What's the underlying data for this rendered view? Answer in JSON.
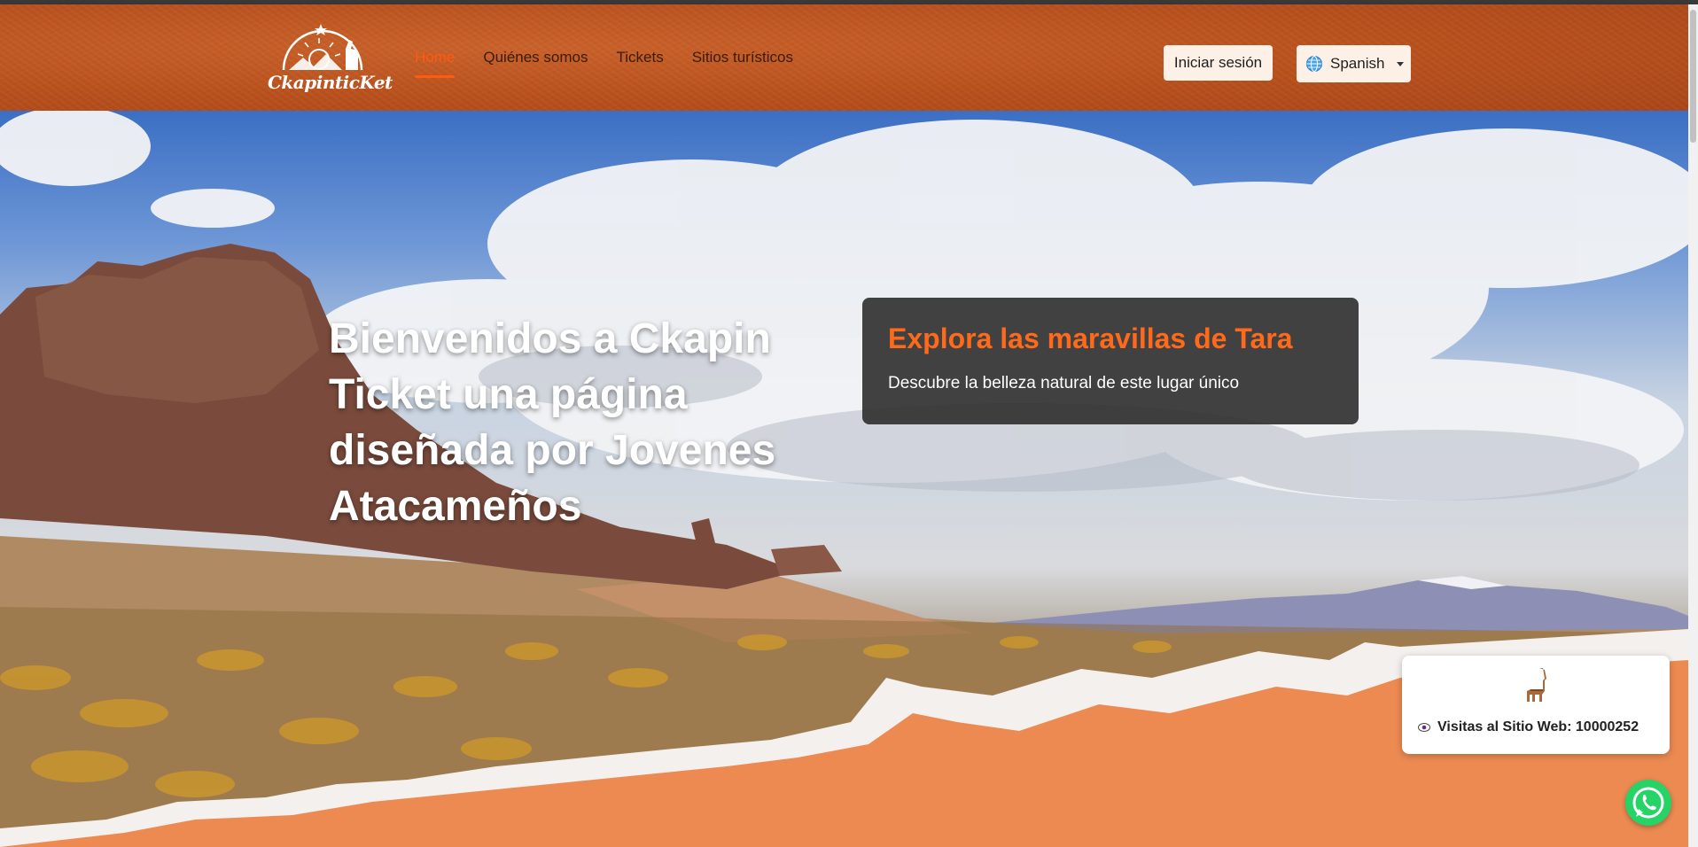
{
  "header": {
    "logo_name": "CkapinticKet",
    "nav": [
      {
        "label": "Home",
        "active": true
      },
      {
        "label": "Quiénes somos",
        "active": false
      },
      {
        "label": "Tickets",
        "active": false
      },
      {
        "label": "Sitios turísticos",
        "active": false
      }
    ],
    "login_label": "Iniciar sesión",
    "language": "Spanish"
  },
  "hero": {
    "title": "Bienvenidos a Ckapin Ticket una página diseñada por Jovenes Atacameños"
  },
  "promo": {
    "title": "Explora las maravillas de Tara",
    "subtitle": "Descubre la belleza natural de este lugar único"
  },
  "visits": {
    "label": "Visitas al Sitio Web: 10000252"
  },
  "colors": {
    "accent": "#ff5a12",
    "header": "#b8501c",
    "whatsapp": "#25d366"
  }
}
